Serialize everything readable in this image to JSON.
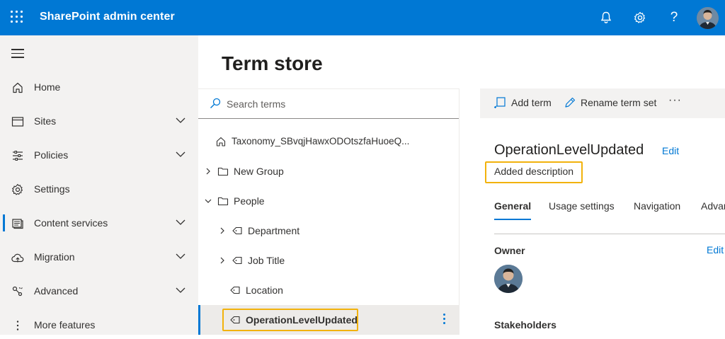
{
  "header": {
    "app_title": "SharePoint admin center",
    "icons": [
      "waffle-icon",
      "bell-icon",
      "gear-icon",
      "help-icon",
      "avatar"
    ]
  },
  "nav": {
    "items": [
      {
        "label": "Home",
        "icon": "home-icon",
        "expandable": false
      },
      {
        "label": "Sites",
        "icon": "sites-icon",
        "expandable": true
      },
      {
        "label": "Policies",
        "icon": "policies-icon",
        "expandable": true
      },
      {
        "label": "Settings",
        "icon": "settings-icon",
        "expandable": false
      },
      {
        "label": "Content services",
        "icon": "content-services-icon",
        "expandable": true,
        "active": true
      },
      {
        "label": "Migration",
        "icon": "migration-icon",
        "expandable": true
      },
      {
        "label": "Advanced",
        "icon": "advanced-icon",
        "expandable": true
      },
      {
        "label": "More features",
        "icon": "more-features-icon",
        "expandable": false
      }
    ]
  },
  "page": {
    "title": "Term store"
  },
  "tree": {
    "search_placeholder": "Search terms",
    "rows": [
      {
        "label": "Taxonomy_SBvqjHawxODOtszfaHuoeQ...",
        "icon": "home-icon",
        "chevron": "none"
      },
      {
        "label": "New Group",
        "icon": "folder-icon",
        "chevron": "right"
      },
      {
        "label": "People",
        "icon": "folder-icon",
        "chevron": "down"
      },
      {
        "label": "Department",
        "icon": "tag-icon",
        "chevron": "right"
      },
      {
        "label": "Job Title",
        "icon": "tag-icon",
        "chevron": "right"
      },
      {
        "label": "Location",
        "icon": "tag-icon",
        "chevron": "none"
      },
      {
        "label": "OperationLevelUpdated",
        "icon": "tag-icon",
        "chevron": "none",
        "selected": true
      }
    ]
  },
  "detail": {
    "toolbar": {
      "add_term": "Add term",
      "rename_term_set": "Rename term set",
      "more": "···"
    },
    "term_name": "OperationLevelUpdated",
    "edit_label": "Edit",
    "description": "Added description",
    "tabs": [
      "General",
      "Usage settings",
      "Navigation",
      "Advanced"
    ],
    "active_tab": "General",
    "owner_label": "Owner",
    "owner_edit": "Edit",
    "stakeholders_label": "Stakeholders"
  },
  "colors": {
    "brand": "#0078d4",
    "highlight": "#f2b20c",
    "nav_bg": "#f3f2f1"
  }
}
